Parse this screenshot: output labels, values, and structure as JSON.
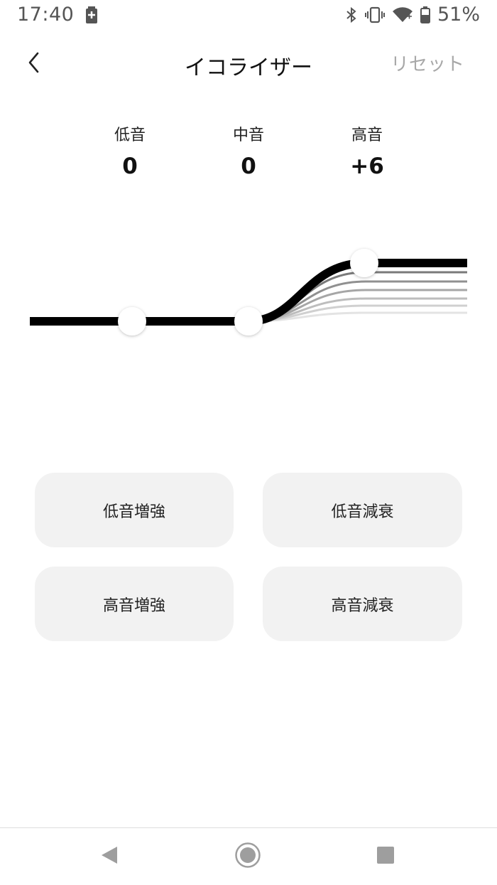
{
  "status_bar": {
    "time": "17:40",
    "battery_percent": "51%",
    "icons": [
      "battery-charging-icon",
      "bluetooth-icon",
      "vibrate-icon",
      "wifi-icon",
      "battery-icon"
    ]
  },
  "header": {
    "title": "イコライザー",
    "reset_label": "リセット",
    "back_icon": "chevron-left-icon"
  },
  "bands": [
    {
      "label": "低音",
      "value": "0"
    },
    {
      "label": "中音",
      "value": "0"
    },
    {
      "label": "高音",
      "value": "+6"
    }
  ],
  "presets": [
    {
      "label": "低音増強"
    },
    {
      "label": "低音減衰"
    },
    {
      "label": "高音増強"
    },
    {
      "label": "高音減衰"
    }
  ],
  "colors": {
    "curve": "#000000",
    "preset_bg": "#f2f2f2",
    "reset_text": "#a8a8a8"
  },
  "nav": {
    "icons": [
      "back-triangle-icon",
      "home-circle-icon",
      "recents-square-icon"
    ]
  }
}
